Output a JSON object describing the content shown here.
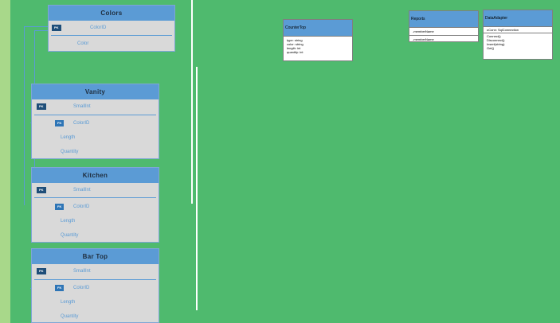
{
  "er_tables": {
    "colors": {
      "title": "Colors",
      "pk_badge": "PK",
      "pk_field": "ColorID",
      "field2": "Color"
    },
    "vanity": {
      "title": "Vanity",
      "pk_badge": "PK",
      "pk_field": "SmallInt",
      "fk_badge": "FK",
      "fk_field": "ColorID",
      "field3": "Length",
      "field4": "Quantity"
    },
    "kitchen": {
      "title": "Kitchen",
      "pk_badge": "PK",
      "pk_field": "SmallInt",
      "fk_badge": "FK",
      "fk_field": "ColorID",
      "field3": "Length",
      "field4": "Quantity"
    },
    "bartop": {
      "title": "Bar Top",
      "pk_badge": "PK",
      "pk_field": "SmallInt",
      "fk_badge": "FK",
      "fk_field": "ColorID",
      "field3": "Length",
      "field4": "Quantity"
    }
  },
  "uml": {
    "countertop": {
      "title": "CounterTop",
      "items": [
        "type: string",
        "color: string",
        "length: int",
        "quantity: int"
      ]
    },
    "reports": {
      "title": "Reports",
      "items": [
        "-memberName",
        "-memberName"
      ]
    },
    "dataadapter": {
      "title": "DataAdapter",
      "field": "oConn: SqlConnection",
      "methods": [
        "Connect()",
        "Disconnect()",
        "Insert(string)",
        "Get()"
      ]
    }
  },
  "colors": {
    "background": "#4fba6e",
    "strip": "#a8d88a",
    "header": "#5b9bd5",
    "table_body": "#d9d9d9"
  }
}
